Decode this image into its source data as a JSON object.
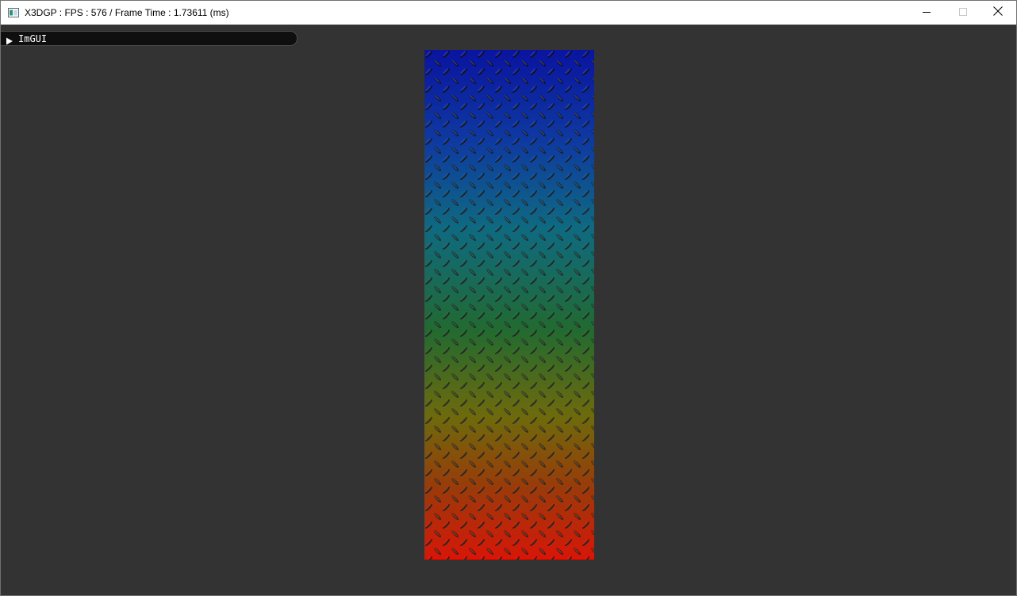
{
  "window": {
    "title": "X3DGP : FPS : 576 / Frame Time : 1.73611 (ms)",
    "icon": "app-window-icon",
    "controls": [
      "minimize-icon",
      "maximize-icon",
      "close-icon"
    ]
  },
  "imgui": {
    "header_label": "ImGUI",
    "expanded": false,
    "arrow_icon": "collapsed-triangle-icon"
  },
  "scene": {
    "object": "diamond-plate-textured-quad",
    "gradient_colors": [
      "#0a1aa8",
      "#106a86",
      "#257a3a",
      "#8a7a10",
      "#d81a10"
    ],
    "background": "#333333"
  }
}
